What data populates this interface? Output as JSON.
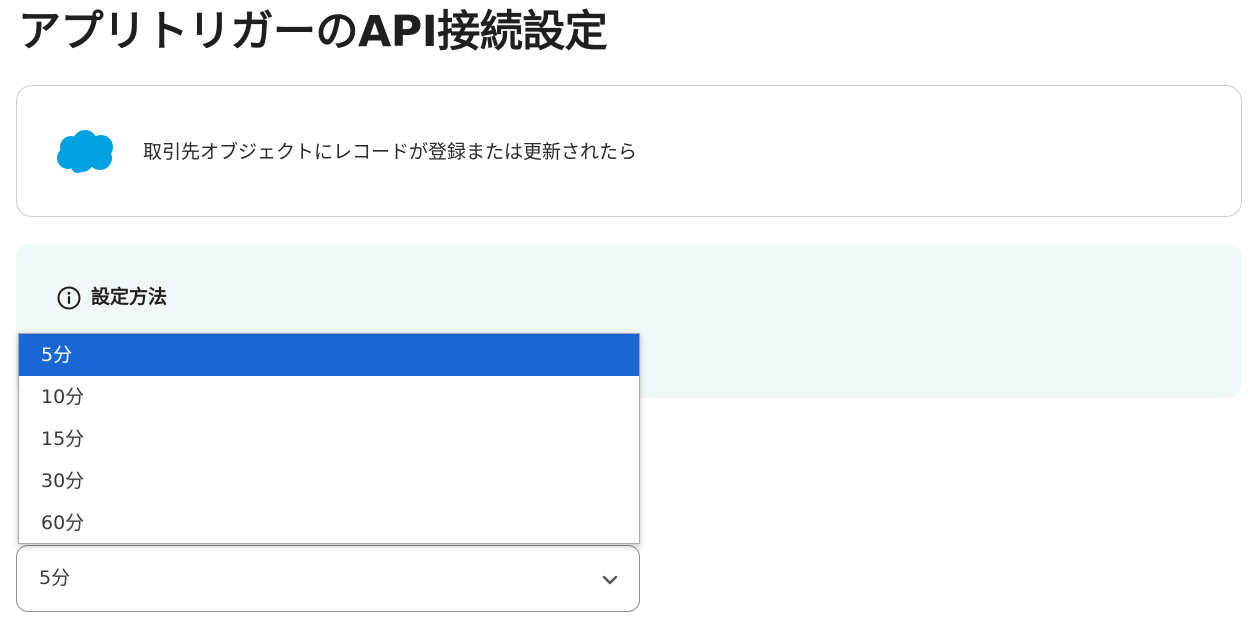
{
  "page": {
    "title": "アプリトリガーのAPI接続設定"
  },
  "trigger": {
    "icon": "salesforce-cloud-icon",
    "description": "取引先オブジェクトにレコードが登録または更新されたら"
  },
  "info": {
    "icon": "info-circle-icon",
    "title": "設定方法"
  },
  "interval_select": {
    "selected_value": "5分",
    "options": [
      "5分",
      "10分",
      "15分",
      "30分",
      "60分"
    ],
    "highlighted_index": 0
  },
  "colors": {
    "brand_salesforce": "#00a1e0",
    "info_panel_bg": "#f1f9f8",
    "option_highlight": "#1a67d4"
  }
}
